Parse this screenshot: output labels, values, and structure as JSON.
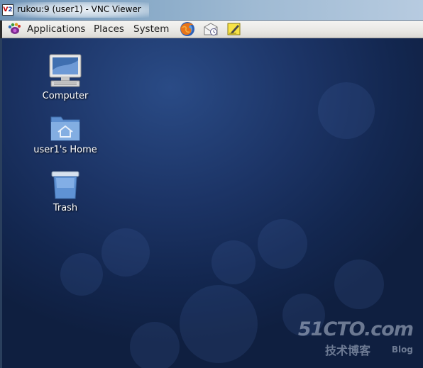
{
  "window": {
    "title": "rukou:9 (user1) - VNC Viewer",
    "app_icon_text_a": "V",
    "app_icon_text_b": "2"
  },
  "panel": {
    "menus": [
      {
        "label": "Applications"
      },
      {
        "label": "Places"
      },
      {
        "label": "System"
      }
    ],
    "launchers": [
      {
        "icon": "firefox-icon"
      },
      {
        "icon": "evolution-mail-icon"
      },
      {
        "icon": "notes-icon"
      }
    ]
  },
  "desktop": {
    "icons": [
      {
        "label": "Computer",
        "icon": "computer-icon"
      },
      {
        "label": "user1's Home",
        "icon": "home-folder-icon"
      },
      {
        "label": "Trash",
        "icon": "trash-icon"
      }
    ]
  },
  "watermark": {
    "main": "51CTO.com",
    "sub": "技术博客",
    "blog": "Blog"
  },
  "colors": {
    "desktop_bg": "#1c3466",
    "panel_bg": "#e9e8e4",
    "titlebar_bg": "#86a8c6"
  }
}
